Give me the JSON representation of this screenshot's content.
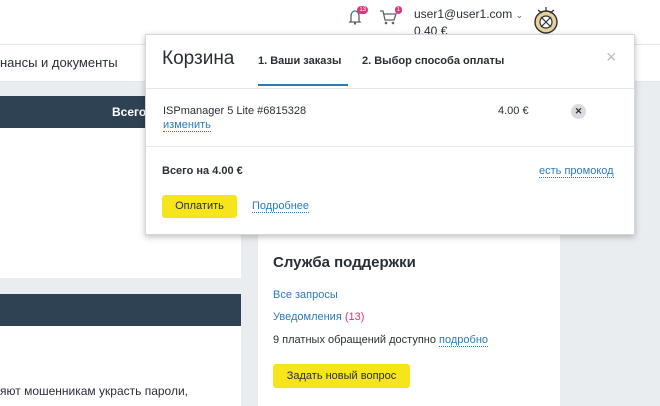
{
  "header": {
    "user_email": "user1@user1.com",
    "balance": "0.40 €",
    "notifications_count": "13",
    "cart_count": "1"
  },
  "nav": {
    "finance_docs": "нансы и документы"
  },
  "left_panel": {
    "header_text": "Всего",
    "bottom_text": "яют мошенникам украсть пароли,"
  },
  "support": {
    "title": "Служба поддержки",
    "all_requests": "Все запросы",
    "notifications_label": "Уведомления",
    "notifications_count": "(13)",
    "paid_requests_text": "9 платных обращений доступно",
    "more_link": "подробно",
    "ask_button": "Задать новый вопрос"
  },
  "cart": {
    "title": "Корзина",
    "tab_orders": "1. Ваши заказы",
    "tab_payment": "2. Выбор способа оплаты",
    "close_symbol": "×",
    "item_name": "ISPmanager 5 Lite #6815328",
    "edit_link": "изменить",
    "item_price": "4.00 €",
    "remove_symbol": "✕",
    "total_text": "Всего на 4.00 €",
    "promo_link": "есть промокод",
    "pay_button": "Оплатить",
    "details_link": "Подробнее"
  },
  "colors": {
    "accent_yellow": "#f6e51a",
    "link_blue": "#2a7bbd",
    "badge_pink": "#e0357a",
    "panel_dark": "#2f4253"
  },
  "icons": [
    "bell-icon",
    "cart-icon",
    "chevron-down-icon",
    "avatar-icon",
    "close-icon",
    "remove-icon"
  ]
}
